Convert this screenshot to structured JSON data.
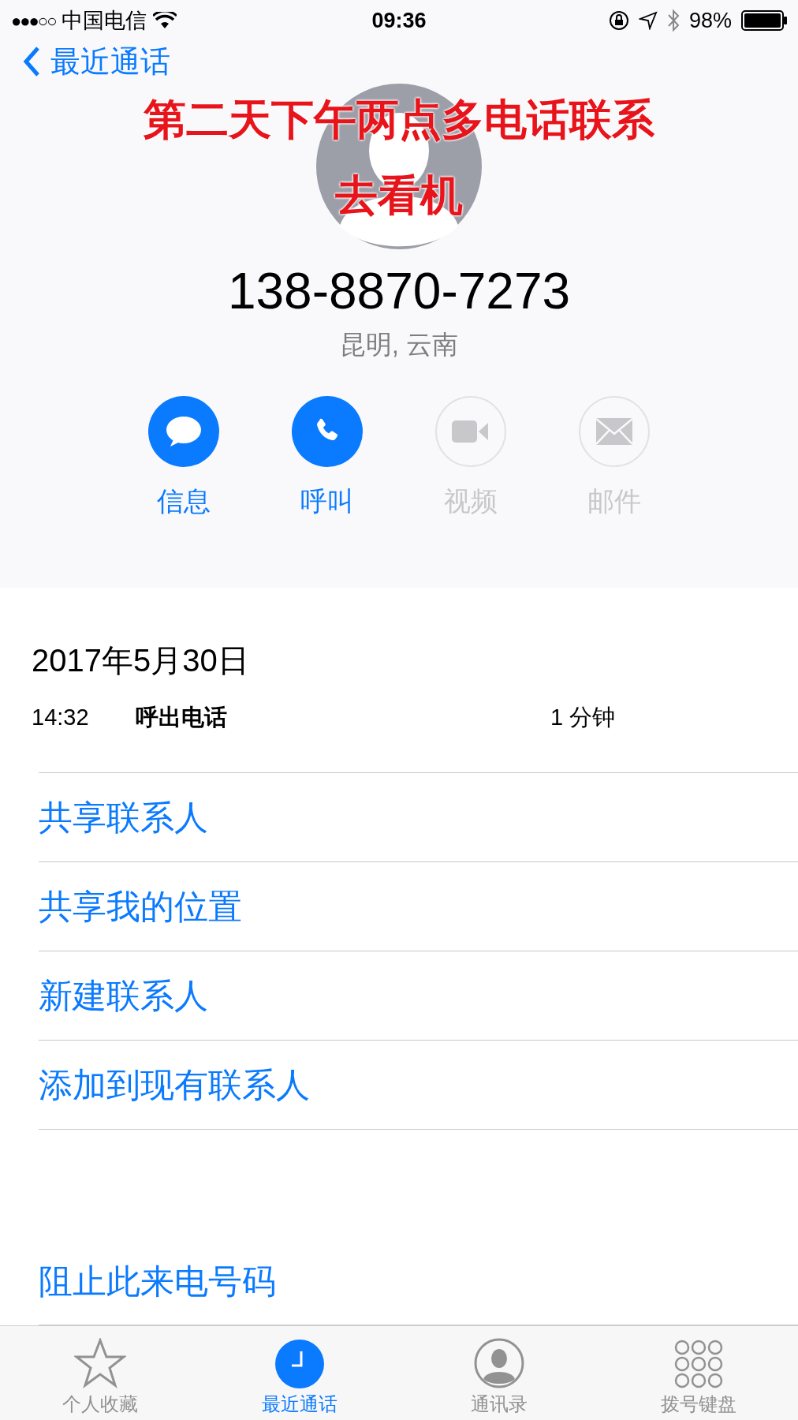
{
  "status_bar": {
    "signal_text": "●●●○○",
    "carrier": "中国电信",
    "time": "09:36",
    "battery": "98%"
  },
  "nav": {
    "back_label": "最近通话"
  },
  "annotation": [
    "第二天下午两点多电话联系",
    "去看机"
  ],
  "contact": {
    "number": "138-8870-7273",
    "location": "昆明, 云南"
  },
  "actions": [
    {
      "kind": "message",
      "label": "信息",
      "disabled": false
    },
    {
      "kind": "call",
      "label": "呼叫",
      "disabled": false
    },
    {
      "kind": "video",
      "label": "视频",
      "disabled": true
    },
    {
      "kind": "mail",
      "label": "邮件",
      "disabled": true
    }
  ],
  "call_log": {
    "date": "2017年5月30日",
    "entries": [
      {
        "time": "14:32",
        "type": "呼出电话",
        "duration": "1 分钟"
      }
    ]
  },
  "options": [
    "共享联系人",
    "共享我的位置",
    "新建联系人",
    "添加到现有联系人"
  ],
  "block_option": "阻止此来电号码",
  "tab_bar": [
    {
      "kind": "favorites",
      "label": "个人收藏",
      "selected": false
    },
    {
      "kind": "recents",
      "label": "最近通话",
      "selected": true
    },
    {
      "kind": "contacts",
      "label": "通讯录",
      "selected": false
    },
    {
      "kind": "keypad",
      "label": "拨号键盘",
      "selected": false
    }
  ]
}
